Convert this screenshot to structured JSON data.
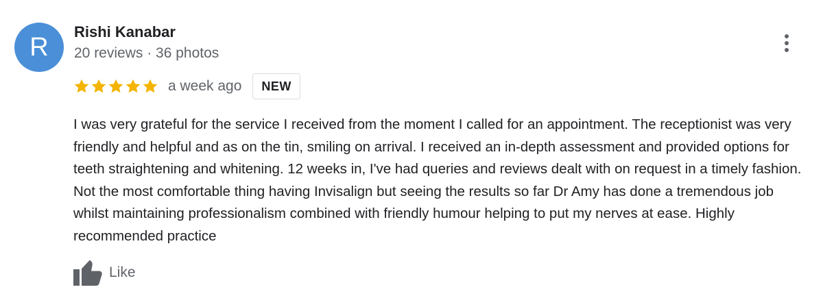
{
  "review": {
    "author": {
      "initial": "R",
      "name": "Rishi Kanabar",
      "meta": "20 reviews · 36 photos",
      "avatar_color": "#4a8fd8"
    },
    "rating": {
      "stars": 5,
      "max_stars": 5,
      "star_color": "#f4b400",
      "star_icon": "star-icon"
    },
    "date": "a week ago",
    "badge": "NEW",
    "text": "I was very grateful for the service I received from the moment I called for an appointment. The receptionist was very friendly and helpful and as on the tin, smiling on arrival. I received an in-depth assessment and provided options for teeth straightening and whitening. 12 weeks in, I've had queries and reviews dealt with on request in a timely fashion. Not the most comfortable thing having Invisalign but seeing the results so far Dr Amy has done a tremendous job whilst maintaining professionalism combined with friendly humour helping to put my nerves at ease. Highly recommended practice",
    "actions": {
      "like_label": "Like",
      "like_icon": "thumbs-up-icon",
      "more_icon": "more-vertical-icon"
    },
    "colors": {
      "primary_text": "#202124",
      "secondary_text": "#5f6368",
      "icon": "#5f6368",
      "badge_border": "#dadce0"
    }
  }
}
